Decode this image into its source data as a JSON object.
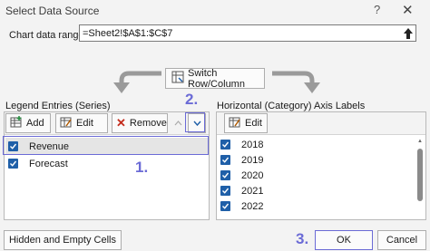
{
  "window": {
    "title": "Select Data Source",
    "help": "?",
    "close": "✕"
  },
  "chart_range": {
    "label": "Chart data range:",
    "value": "=Sheet2!$A$1:$C$7"
  },
  "switch_button": {
    "label": "Switch Row/Column"
  },
  "legend": {
    "label": "Legend Entries (Series)",
    "add": "Add",
    "edit": "Edit",
    "remove": "Remove",
    "items": [
      {
        "label": "Revenue",
        "checked": true,
        "selected": true
      },
      {
        "label": "Forecast",
        "checked": true,
        "selected": false
      }
    ]
  },
  "axis": {
    "label": "Horizontal (Category) Axis Labels",
    "edit": "Edit",
    "items": [
      {
        "label": "2018",
        "checked": true
      },
      {
        "label": "2019",
        "checked": true
      },
      {
        "label": "2020",
        "checked": true
      },
      {
        "label": "2021",
        "checked": true
      },
      {
        "label": "2022",
        "checked": true
      }
    ]
  },
  "buttons": {
    "hidden_empty": "Hidden and Empty Cells",
    "ok": "OK",
    "cancel": "Cancel"
  },
  "annotations": {
    "step1": "1.",
    "step2": "2.",
    "step3": "3."
  },
  "colors": {
    "accent": "#1f5fa8",
    "annotation": "#6b6bd6"
  }
}
